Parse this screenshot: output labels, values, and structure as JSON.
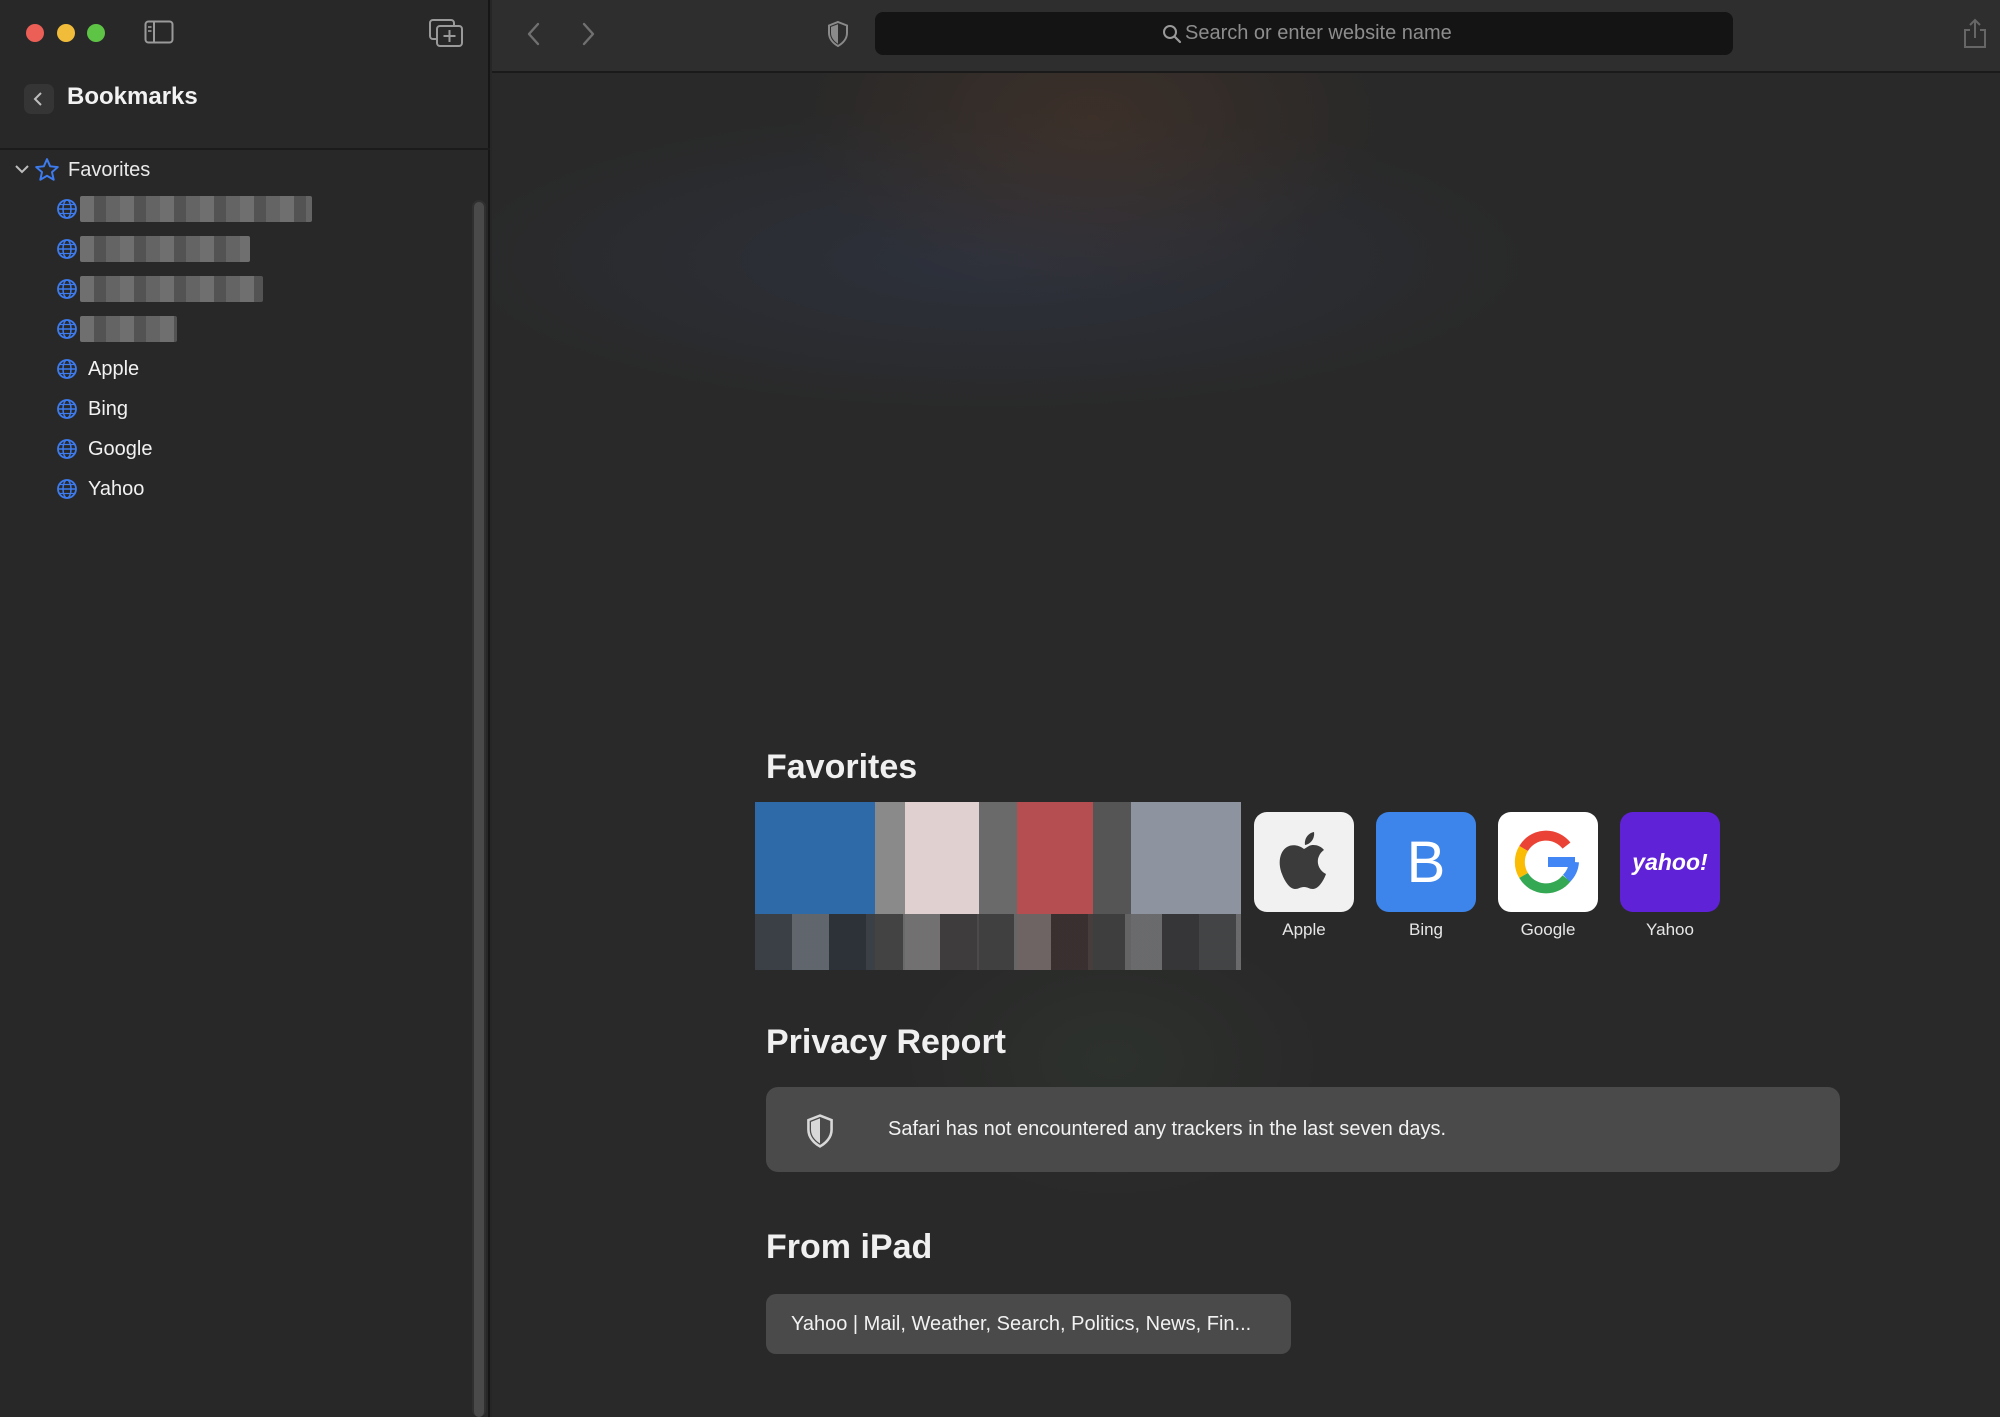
{
  "window": {
    "controls": [
      "close",
      "minimize",
      "zoom"
    ],
    "sidebar_toggle_icon": "sidebar-icon",
    "new_tab_icon": "tab-overview-icon"
  },
  "sidebar": {
    "title": "Bookmarks",
    "favorites_folder": {
      "label": "Favorites",
      "expanded": true
    },
    "bookmarks": [
      {
        "label": "",
        "redacted": true
      },
      {
        "label": "",
        "redacted": true
      },
      {
        "label": "",
        "redacted": true
      },
      {
        "label": "",
        "redacted": true
      },
      {
        "label": "Apple"
      },
      {
        "label": "Bing"
      },
      {
        "label": "Google"
      },
      {
        "label": "Yahoo"
      }
    ]
  },
  "toolbar": {
    "search_placeholder": "Search or enter website name"
  },
  "start_page": {
    "favorites_title": "Favorites",
    "favorites": [
      {
        "label": "Apple",
        "icon": "apple-logo-icon",
        "tile_color": "#f1f1f1"
      },
      {
        "label": "Bing",
        "icon": "letter-b",
        "glyph": "B",
        "tile_color": "#3d85ea"
      },
      {
        "label": "Google",
        "icon": "google-g-icon",
        "tile_color": "#ffffff"
      },
      {
        "label": "Yahoo",
        "icon": "yahoo-logo",
        "glyph": "yahoo!",
        "tile_color": "#5f22d6"
      }
    ],
    "privacy_title": "Privacy Report",
    "privacy_text": "Safari has not encountered any trackers in the last seven days.",
    "ipad_title": "From iPad",
    "ipad_tab": "Yahoo | Mail, Weather, Search, Politics, News, Fin..."
  },
  "colors": {
    "accent": "#3d7cf0",
    "window_bg": "#262626",
    "card_bg": "#4a4a4a"
  }
}
